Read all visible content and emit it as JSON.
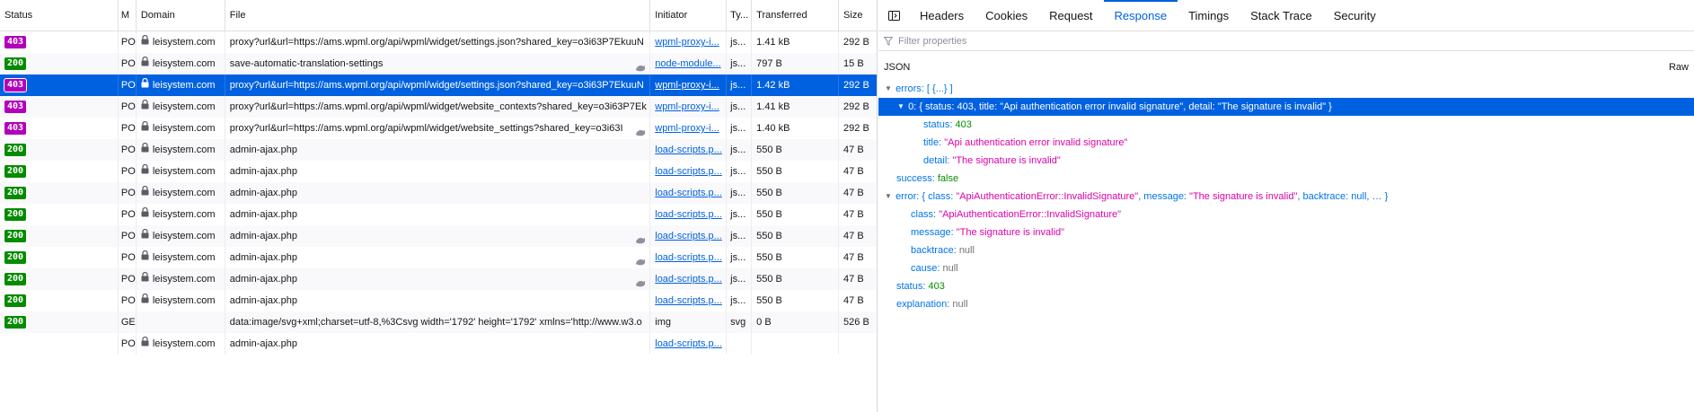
{
  "columns": {
    "status": "Status",
    "method": "M",
    "domain": "Domain",
    "file": "File",
    "initiator": "Initiator",
    "type": "Ty...",
    "transferred": "Transferred",
    "size": "Size"
  },
  "rows": [
    {
      "status": "403",
      "method": "PO",
      "domain": "leisystem.com",
      "file": "proxy?url&url=https://ams.wpml.org/api/wpml/widget/settings.json?shared_key=o3i63P7EkuuN",
      "initiator": "wpml-proxy-i...",
      "type": "js...",
      "transferred": "1.41 kB",
      "size": "292 B"
    },
    {
      "status": "200",
      "method": "PO",
      "domain": "leisystem.com",
      "file": "save-automatic-translation-settings",
      "initiator": "node-module...",
      "type": "js...",
      "transferred": "797 B",
      "size": "15 B"
    },
    {
      "status": "403",
      "method": "PO",
      "domain": "leisystem.com",
      "file": "proxy?url&url=https://ams.wpml.org/api/wpml/widget/settings.json?shared_key=o3i63P7EkuuN",
      "initiator": "wpml-proxy-i...",
      "type": "js...",
      "transferred": "1.42 kB",
      "size": "292 B"
    },
    {
      "status": "403",
      "method": "PO",
      "domain": "leisystem.com",
      "file": "proxy?url&url=https://ams.wpml.org/api/wpml/widget/website_contexts?shared_key=o3i63P7Ek",
      "initiator": "wpml-proxy-i...",
      "type": "js...",
      "transferred": "1.41 kB",
      "size": "292 B"
    },
    {
      "status": "403",
      "method": "PO",
      "domain": "leisystem.com",
      "file": "proxy?url&url=https://ams.wpml.org/api/wpml/widget/website_settings?shared_key=o3i63I",
      "initiator": "wpml-proxy-i...",
      "type": "js...",
      "transferred": "1.40 kB",
      "size": "292 B"
    },
    {
      "status": "200",
      "method": "PO",
      "domain": "leisystem.com",
      "file": "admin-ajax.php",
      "initiator": "load-scripts.p...",
      "type": "js...",
      "transferred": "550 B",
      "size": "47 B"
    },
    {
      "status": "200",
      "method": "PO",
      "domain": "leisystem.com",
      "file": "admin-ajax.php",
      "initiator": "load-scripts.p...",
      "type": "js...",
      "transferred": "550 B",
      "size": "47 B"
    },
    {
      "status": "200",
      "method": "PO",
      "domain": "leisystem.com",
      "file": "admin-ajax.php",
      "initiator": "load-scripts.p...",
      "type": "js...",
      "transferred": "550 B",
      "size": "47 B"
    },
    {
      "status": "200",
      "method": "PO",
      "domain": "leisystem.com",
      "file": "admin-ajax.php",
      "initiator": "load-scripts.p...",
      "type": "js...",
      "transferred": "550 B",
      "size": "47 B"
    },
    {
      "status": "200",
      "method": "PO",
      "domain": "leisystem.com",
      "file": "admin-ajax.php",
      "initiator": "load-scripts.p...",
      "type": "js...",
      "transferred": "550 B",
      "size": "47 B"
    },
    {
      "status": "200",
      "method": "PO",
      "domain": "leisystem.com",
      "file": "admin-ajax.php",
      "initiator": "load-scripts.p...",
      "type": "js...",
      "transferred": "550 B",
      "size": "47 B"
    },
    {
      "status": "200",
      "method": "PO",
      "domain": "leisystem.com",
      "file": "admin-ajax.php",
      "initiator": "load-scripts.p...",
      "type": "js...",
      "transferred": "550 B",
      "size": "47 B"
    },
    {
      "status": "200",
      "method": "PO",
      "domain": "leisystem.com",
      "file": "admin-ajax.php",
      "initiator": "load-scripts.p...",
      "type": "js...",
      "transferred": "550 B",
      "size": "47 B"
    },
    {
      "status": "200",
      "method": "GE",
      "domain": "",
      "file": "data:image/svg+xml;charset=utf-8,%3Csvg width='1792' height='1792' xmlns='http://www.w3.o",
      "initiator": "img",
      "type": "svg",
      "transferred": "0 B",
      "size": "526 B"
    },
    {
      "status": "",
      "method": "PO",
      "domain": "leisystem.com",
      "file": "admin-ajax.php",
      "initiator": "load-scripts.p...",
      "type": "",
      "transferred": "",
      "size": ""
    }
  ],
  "details": {
    "tabs": [
      "Headers",
      "Cookies",
      "Request",
      "Response",
      "Timings",
      "Stack Trace",
      "Security"
    ],
    "active_tab": "Response",
    "filter_placeholder": "Filter properties",
    "json_label": "JSON",
    "raw_label": "Raw",
    "tree": {
      "errors_key": "errors:",
      "errors_summary": "[ {...} ]",
      "item0_key": "0:",
      "item0_summary": "{ status: 403, title: \"Api authentication error invalid signature\", detail: \"The signature is invalid\" }",
      "status_key": "status:",
      "status_val": "403",
      "title_key": "title:",
      "title_val": "\"Api authentication error invalid signature\"",
      "detail_key": "detail:",
      "detail_val": "\"The signature is invalid\"",
      "success_key": "success:",
      "success_val": "false",
      "error_key": "error:",
      "error_summary_open": "{ class: ",
      "error_summary_class": "\"ApiAuthenticationError::InvalidSignature\"",
      "error_summary_mid": ", message: ",
      "error_summary_msg": "\"The signature is invalid\"",
      "error_summary_end": ", backtrace: null, … }",
      "class_key": "class:",
      "class_val": "\"ApiAuthenticationError::InvalidSignature\"",
      "message_key": "message:",
      "message_val": "\"The signature is invalid\"",
      "backtrace_key": "backtrace:",
      "backtrace_val": "null",
      "cause_key": "cause:",
      "cause_val": "null",
      "status2_key": "status:",
      "status2_val": "403",
      "explanation_key": "explanation:",
      "explanation_val": "null"
    }
  },
  "selected_row": 2,
  "tracker_rows": [
    1,
    4,
    9,
    10,
    11
  ],
  "colors": {
    "status_403": "#b200ba",
    "status_200": "#058b00",
    "selection": "#0061e0",
    "link": "#0060df"
  }
}
